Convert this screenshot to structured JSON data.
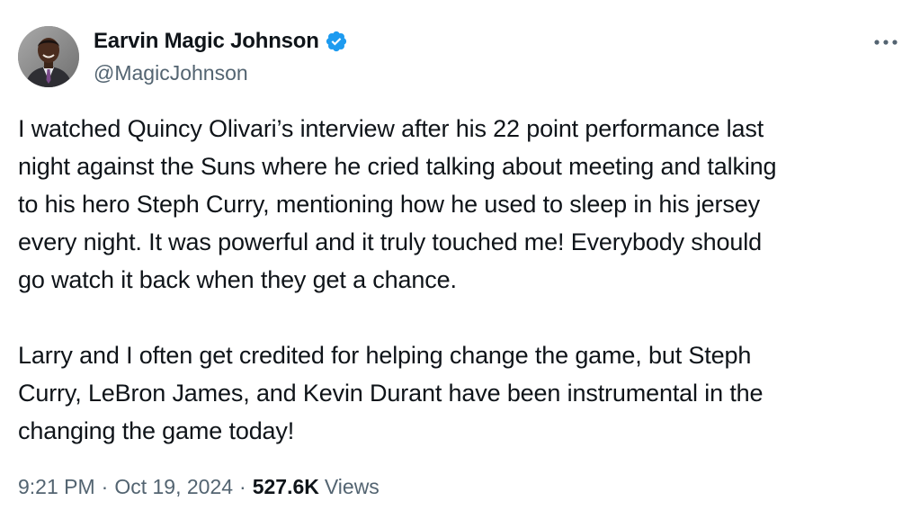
{
  "author": {
    "display_name": "Earvin Magic Johnson",
    "handle": "@MagicJohnson",
    "verified": true
  },
  "icons": {
    "avatar": "profile-photo",
    "verified": "verified-badge-icon",
    "more": "more-options-icon"
  },
  "colors": {
    "text": "#0f1419",
    "secondary": "#536471",
    "verified_blue": "#1d9bf0"
  },
  "tweet": {
    "paragraph1_lines": [
      "I watched Quincy Olivari’s interview after his 22 point performance last",
      "night against the Suns where he cried talking about meeting and talking",
      "to his hero Steph Curry, mentioning how he used to sleep in his jersey",
      "every night. It was powerful and it truly touched me! Everybody should",
      "go watch it back when they get a chance."
    ],
    "paragraph2_lines": [
      "Larry and I often get credited for helping change the game, but Steph",
      "Curry, LeBron James, and Kevin Durant have been instrumental in the",
      "changing the game today!"
    ]
  },
  "meta": {
    "time": "9:21 PM",
    "separator": "·",
    "date": "Oct 19, 2024",
    "views_count": "527.6K",
    "views_label": "Views"
  }
}
